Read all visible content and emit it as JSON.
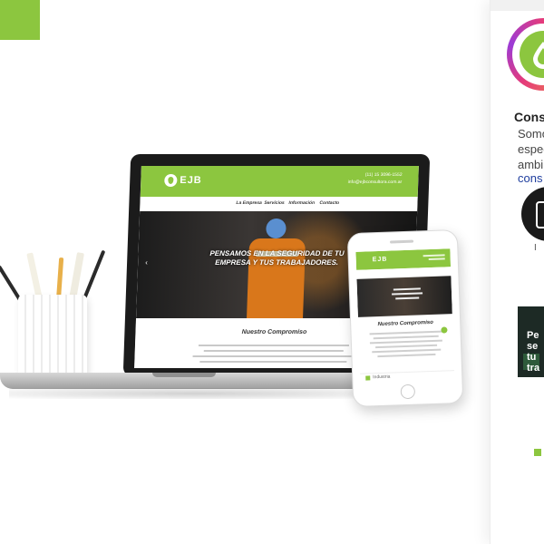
{
  "colors": {
    "brand_green": "#8cc63f",
    "dark": "#1b1b1b",
    "link_blue": "#1f3e9e"
  },
  "laptop_site": {
    "logo_text": "EJB",
    "contact_phone": "(11) 15 3096-1552",
    "contact_email": "info@ejbconsultora.com.ar",
    "nav": [
      "La Empresa",
      "Servicios",
      "Información",
      "Contacto"
    ],
    "hero_text": "PENSAMOS EN LA SEGURIDAD DE TU EMPRESA Y TUS TRABAJADORES.",
    "prev_arrow": "‹",
    "section_title": "Nuestro Compromiso"
  },
  "phone_site": {
    "logo_text": "EJB",
    "section_title": "Nuestro Compromiso",
    "footer_label": "Industria"
  },
  "side_card": {
    "heading": "Cons",
    "lines": [
      "Somo",
      "espec",
      "ambi"
    ],
    "link_line": "cons",
    "small_letter": "I",
    "panel_lines": [
      "Pe",
      "se",
      "tu",
      "tra"
    ]
  }
}
